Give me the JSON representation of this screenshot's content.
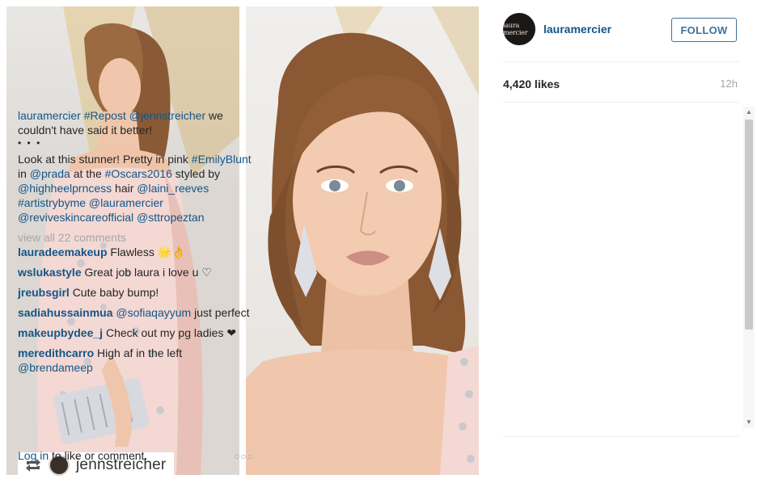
{
  "post": {
    "username": "lauramercier",
    "avatar_text": "laura mercier",
    "follow_label": "FOLLOW",
    "likes": "4,420 likes",
    "time": "12h",
    "repost_username": "jennstreicher"
  },
  "caption": {
    "user": "lauramercier",
    "tags_line": "#Repost @jennstreicher",
    "line_rest": " we couldn't have said it better!",
    "dots": "• • •",
    "body_start": "Look at this stunner! Pretty in pink ",
    "tag_emily": "#EmilyBlunt",
    "in": " in ",
    "tag_prada": "@prada",
    "at_the": " at the ",
    "tag_oscars": "#Oscars2016",
    "styled_by": " styled by ",
    "tag_heel": "@highheelprncess",
    "hair": " hair ",
    "tag_laini": "@laini_reeves",
    "tag_artistry": "#artistrybyme",
    "tag_lm": "@lauramercier",
    "tag_revive": "@reviveskincareofficial",
    "tag_sttropez": "@sttropeztan"
  },
  "view_all": "view all 22 comments",
  "comments": [
    {
      "user": "lauradeemakeup",
      "text": "Flawless 🌟👌",
      "mention": ""
    },
    {
      "user": "wslukastyle",
      "text": "Great job laura i love u ♡",
      "mention": ""
    },
    {
      "user": "jreubsgirl",
      "text": "Cute baby bump!",
      "mention": ""
    },
    {
      "user": "sadiahussainmua",
      "text": " just perfect",
      "mention": "@sofiaqayyum"
    },
    {
      "user": "makeupbydee_j",
      "text": "Check out my pg ladies ❤",
      "mention": ""
    },
    {
      "user": "meredithcarro",
      "text": "High af in the left",
      "mention": "@brendameep"
    }
  ],
  "footer": {
    "login": "Log in",
    "rest": " to like or comment.",
    "more": "○○○"
  },
  "scroll": {
    "up": "▲",
    "down": "▼"
  },
  "icons": {
    "repost": "repost-icon",
    "avatar": "avatar",
    "more": "more-options-icon"
  },
  "colors": {
    "link": "#125688",
    "follow": "#3f729b",
    "muted": "#a5a7aa"
  }
}
